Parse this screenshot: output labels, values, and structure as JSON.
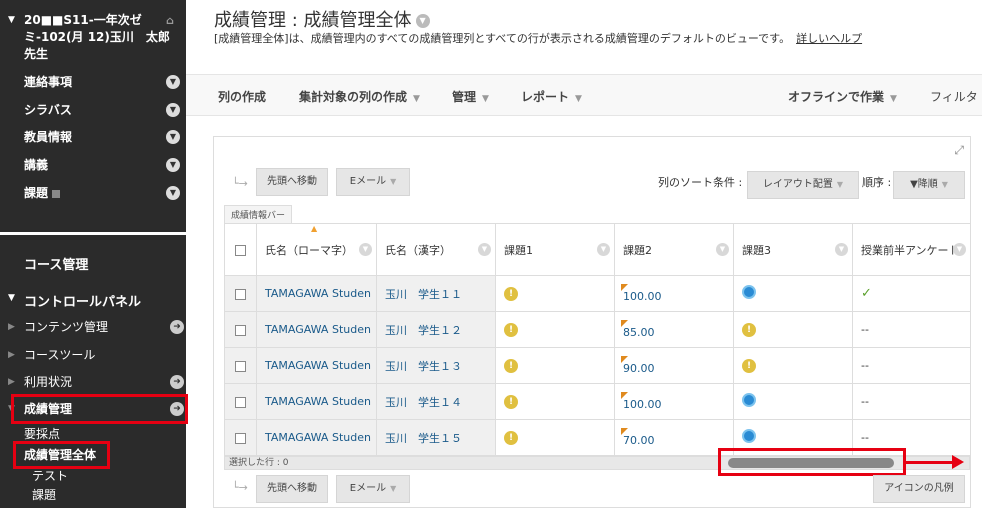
{
  "sidebar": {
    "course_title": "20■■S11-一年次ゼミ-102(月 12)玉川　太郎先生",
    "menu": [
      "連絡事項",
      "シラバス",
      "教員情報",
      "講義",
      "課題"
    ],
    "course_mgmt": "コース管理",
    "control_panel": "コントロールパネル",
    "cp_items": [
      "コンテンツ管理",
      "コースツール",
      "利用状況",
      "成績管理"
    ],
    "sub_items": [
      "要採点",
      "成績管理全体",
      "テスト",
      "課題"
    ]
  },
  "header": {
    "title": "成績管理 : 成績管理全体",
    "desc": "[成績管理全体]は、成績管理内のすべての成績管理列とすべての行が表示される成績管理のデフォルトのビューです。",
    "help": "詳しいヘルプ"
  },
  "toolbar": {
    "create_col": "列の作成",
    "create_calc": "集計対象の列の作成",
    "manage": "管理",
    "report": "レポート",
    "offline": "オフラインで作業",
    "filter": "フィルタ"
  },
  "grid_controls": {
    "move_top": "先頭へ移動",
    "email": "Eメール",
    "sort_label": "列のソート条件 :",
    "sort_value": "レイアウト配置",
    "order_label": "順序 :",
    "order_value": "▼降順",
    "info_bar": "成績情報バー",
    "selected_rows": "選択した行 : 0",
    "legend": "アイコンの凡例"
  },
  "columns": [
    "氏名（ローマ字）",
    "氏名（漢字）",
    "課題1",
    "課題2",
    "課題3",
    "授業前半アンケート"
  ],
  "rows": [
    {
      "roman": "TAMAGAWA Studen",
      "kanji": "玉川　学生１１",
      "k1": "warn",
      "k2": "100.00",
      "k3": "clock",
      "survey": "✓"
    },
    {
      "roman": "TAMAGAWA Studen",
      "kanji": "玉川　学生１２",
      "k1": "warn",
      "k2": "85.00",
      "k3": "warn",
      "survey": "--"
    },
    {
      "roman": "TAMAGAWA Studen",
      "kanji": "玉川　学生１３",
      "k1": "warn",
      "k2": "90.00",
      "k3": "warn",
      "survey": "--"
    },
    {
      "roman": "TAMAGAWA Studen",
      "kanji": "玉川　学生１４",
      "k1": "warn",
      "k2": "100.00",
      "k3": "clock",
      "survey": "--"
    },
    {
      "roman": "TAMAGAWA Studen",
      "kanji": "玉川　学生１５",
      "k1": "warn",
      "k2": "70.00",
      "k3": "clock",
      "survey": "--"
    }
  ],
  "icons": {
    "warn": "!",
    "check": "✓"
  },
  "colors": {
    "highlight": "#e60012",
    "sidebar": "#2b2b2b",
    "link": "#1a5a8a"
  }
}
